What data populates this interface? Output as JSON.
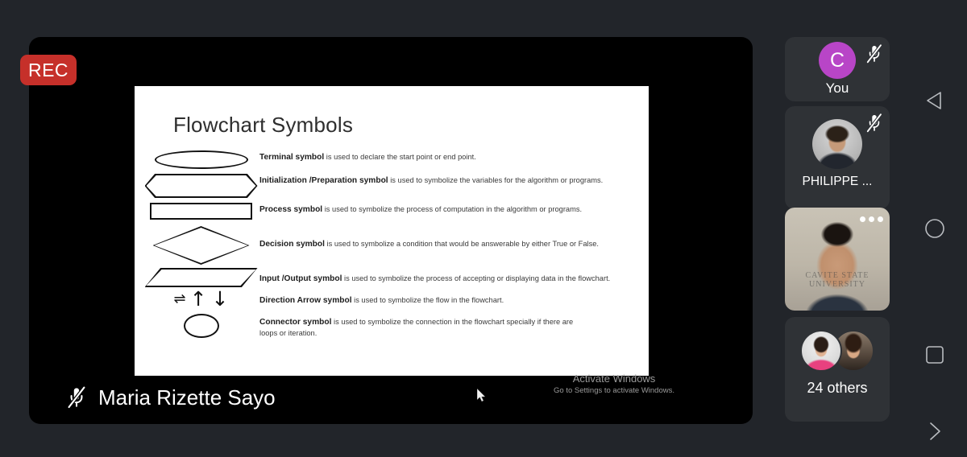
{
  "recording": {
    "badge_label": "REC",
    "color": "#c6302a"
  },
  "slide": {
    "title": "Flowchart Symbols",
    "rows": [
      {
        "symbol": "ellipse",
        "term": "Terminal symbol",
        "desc": " is used to declare the start point or end point."
      },
      {
        "symbol": "hexagon",
        "term": "Initialization /Preparation symbol",
        "desc": " is used to symbolize the variables for the algorithm or programs."
      },
      {
        "symbol": "rectangle",
        "term": "Process symbol",
        "desc": " is used to symbolize the process of computation in the algorithm or programs."
      },
      {
        "symbol": "diamond",
        "term": "Decision symbol",
        "desc": " is used to symbolize a condition that would be answerable by either True or False."
      },
      {
        "symbol": "parallelogram",
        "term": "Input /Output symbol",
        "desc": " is used to symbolize the process of accepting or displaying data in the flowchart."
      },
      {
        "symbol": "arrows",
        "term": "Direction Arrow symbol",
        "desc": " is used to symbolize the flow in the flowchart."
      },
      {
        "symbol": "circle",
        "term": "Connector symbol",
        "desc": " is used to symbolize the connection in the flowchart specially if there are loops or iteration."
      }
    ]
  },
  "watermark": {
    "line1": "Activate Windows",
    "line2": "Go to Settings to activate Windows."
  },
  "presenter": {
    "name": "Maria Rizette Sayo",
    "mic_icon": "mic-off-icon"
  },
  "participants": [
    {
      "label": "You",
      "avatar_initial": "C",
      "avatar_color": "#b845c7",
      "muted": true,
      "type": "initial"
    },
    {
      "label": "PHILIPPE ...",
      "muted": true,
      "type": "photo"
    },
    {
      "label": "",
      "muted": false,
      "type": "video",
      "overlay_text": "CAVITE STATE UNIVERSITY",
      "menu_icon": "more-options-icon"
    },
    {
      "label": "24 others",
      "muted": false,
      "type": "group"
    }
  ],
  "nav": {
    "back": "back-icon",
    "home": "home-icon",
    "recents": "recents-icon",
    "next": "next-icon"
  }
}
